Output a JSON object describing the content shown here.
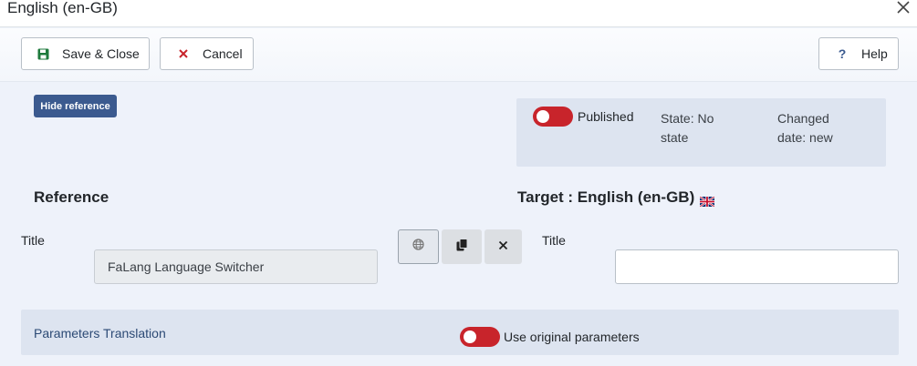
{
  "window": {
    "title": "English (en-GB)",
    "close_icon": "close-icon"
  },
  "toolbar": {
    "save_label": "Save & Close",
    "cancel_label": "Cancel",
    "help_label": "Help",
    "save_icon": "floppy-disk-icon",
    "cancel_icon": "x-icon",
    "help_icon": "question-mark-icon"
  },
  "reference_toggle": {
    "label": "Hide reference"
  },
  "status": {
    "published_label": "Published",
    "published_on": false,
    "state_text": "State: No state",
    "changed_text": "Changed date: new"
  },
  "reference": {
    "heading": "Reference",
    "title_label": "Title",
    "title_value": "FaLang Language Switcher"
  },
  "target": {
    "heading": "Target : English (en-GB)",
    "flag_icon": "uk-flag-icon",
    "title_label": "Title",
    "title_value": ""
  },
  "actions": {
    "translate_icon": "globe-icon",
    "copy_icon": "copy-icon",
    "clear_icon": "close-icon"
  },
  "parameters": {
    "label": "Parameters Translation",
    "use_original_label": "Use original parameters",
    "use_original_on": false
  },
  "colors": {
    "accent": "#3b5a8f",
    "toggle_off": "#c8242b",
    "panel": "#dde4f0",
    "page_bg": "#eef2fa"
  }
}
